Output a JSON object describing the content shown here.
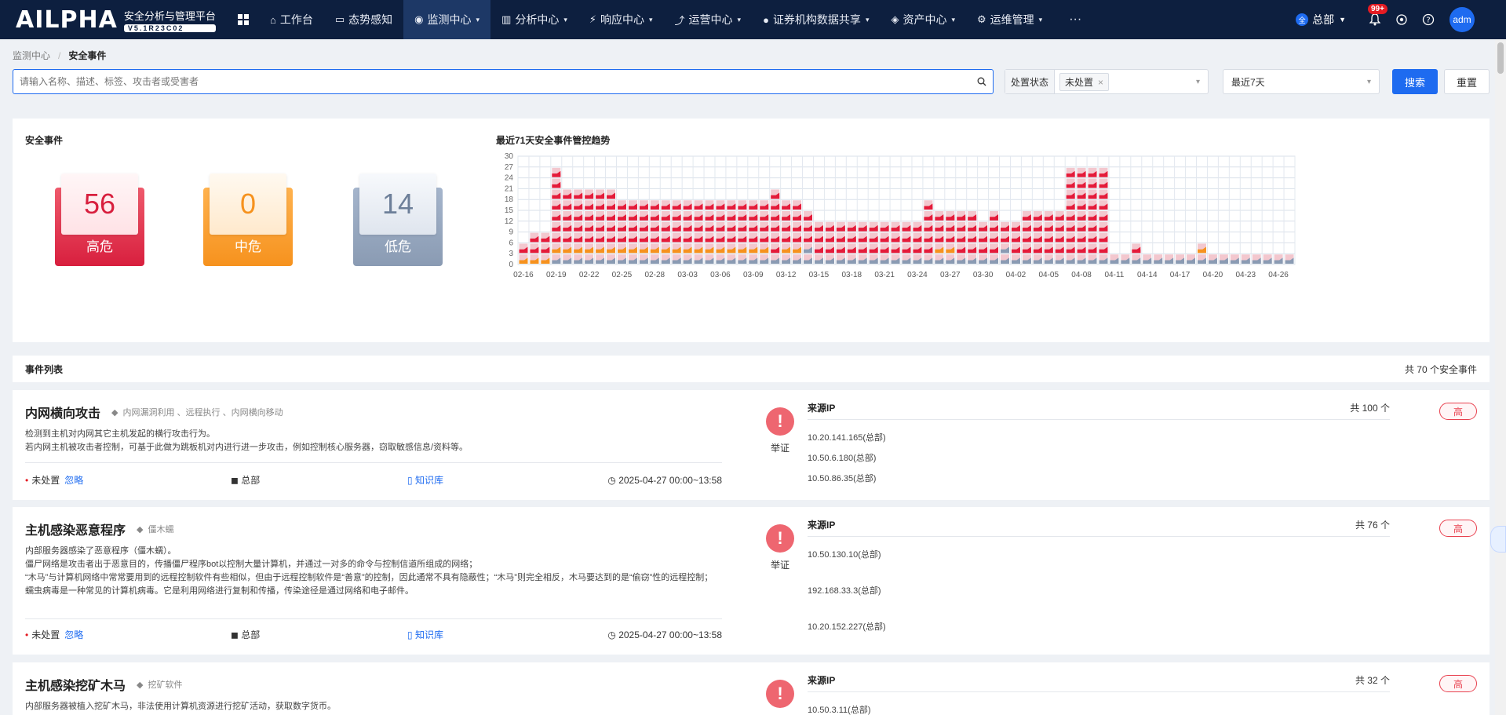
{
  "brand": {
    "logo_word": "AILPHA",
    "product_title": "安全分析与管理平台",
    "version": "V5.1R23C02"
  },
  "nav": {
    "items": [
      {
        "label": "工作台",
        "icon": "home-icon",
        "has_menu": false
      },
      {
        "label": "态势感知",
        "icon": "monitor-icon",
        "has_menu": false
      },
      {
        "label": "监测中心",
        "icon": "radar-icon",
        "has_menu": true,
        "active": true
      },
      {
        "label": "分析中心",
        "icon": "bar-chart-icon",
        "has_menu": true
      },
      {
        "label": "响应中心",
        "icon": "bolt-icon",
        "has_menu": true
      },
      {
        "label": "运营中心",
        "icon": "trend-icon",
        "has_menu": true
      },
      {
        "label": "证券机构数据共享",
        "icon": "share-icon",
        "has_menu": true
      },
      {
        "label": "资产中心",
        "icon": "layers-icon",
        "has_menu": true
      },
      {
        "label": "运维管理",
        "icon": "tools-icon",
        "has_menu": true
      }
    ],
    "more_label": "···",
    "branch_badge": "全",
    "branch": "总部",
    "notification_count": "99+",
    "user": "adm"
  },
  "breadcrumb": {
    "parent": "监测中心",
    "current": "安全事件"
  },
  "search": {
    "placeholder": "请输入名称、描述、标签、攻击者或受害者",
    "value": "",
    "status_label": "处置状态",
    "status_tag": "未处置",
    "range": "最近7天",
    "search_label": "搜索",
    "reset_label": "重置"
  },
  "overview": {
    "title": "安全事件",
    "trend_title": "最近71天安全事件管控趋势",
    "high": {
      "value": "56",
      "label": "高危"
    },
    "mid": {
      "value": "0",
      "label": "中危"
    },
    "low": {
      "value": "14",
      "label": "低危"
    }
  },
  "colors": {
    "high": "#e41b3a",
    "mid": "#f6921e",
    "low": "#8a9bb3",
    "accent": "#1e6bf0",
    "nav_bg": "#0d1f3f"
  },
  "chart_data": {
    "type": "bar",
    "title": "最近71天安全事件管控趋势",
    "xlabel": "",
    "ylabel": "",
    "ylim": [
      0,
      30
    ],
    "yticks": [
      0,
      3,
      6,
      9,
      12,
      15,
      18,
      21,
      24,
      27,
      30
    ],
    "grid": true,
    "stacked": true,
    "x_start": "2025-02-16",
    "xtick_labels": [
      "02-16",
      "02-19",
      "02-22",
      "02-25",
      "02-28",
      "03-03",
      "03-06",
      "03-09",
      "03-12",
      "03-15",
      "03-18",
      "03-21",
      "03-24",
      "03-27",
      "03-30",
      "04-02",
      "04-05",
      "04-08",
      "04-11",
      "04-14",
      "04-17",
      "04-20",
      "04-23",
      "04-26"
    ],
    "series": [
      {
        "name": "低危",
        "values": [
          0,
          0,
          0,
          1,
          1,
          1,
          1,
          1,
          1,
          1,
          1,
          1,
          1,
          1,
          1,
          1,
          1,
          1,
          1,
          1,
          1,
          1,
          1,
          1,
          1,
          1,
          2,
          1,
          1,
          1,
          1,
          1,
          1,
          1,
          1,
          1,
          1,
          1,
          1,
          1,
          1,
          1,
          1,
          1,
          2,
          1,
          1,
          1,
          1,
          1,
          1,
          1,
          1,
          1,
          1,
          1,
          1,
          1,
          1,
          1,
          1,
          1,
          1,
          1,
          1,
          1,
          1,
          1,
          1,
          1,
          1
        ]
      },
      {
        "name": "中危",
        "values": [
          1,
          1,
          1,
          1,
          1,
          1,
          1,
          1,
          1,
          1,
          1,
          1,
          1,
          1,
          1,
          1,
          1,
          1,
          1,
          1,
          1,
          1,
          1,
          0,
          1,
          1,
          0,
          0,
          0,
          0,
          0,
          0,
          0,
          0,
          0,
          0,
          0,
          0,
          1,
          1,
          0,
          0,
          0,
          0,
          0,
          0,
          0,
          0,
          0,
          0,
          0,
          0,
          0,
          0,
          0,
          0,
          0,
          0,
          0,
          0,
          0,
          0,
          1,
          0,
          0,
          0,
          0,
          0,
          0,
          0,
          0
        ]
      },
      {
        "name": "高危",
        "values": [
          1,
          2,
          2,
          7,
          5,
          5,
          5,
          5,
          5,
          4,
          4,
          4,
          4,
          4,
          4,
          4,
          4,
          4,
          4,
          4,
          4,
          4,
          4,
          6,
          4,
          4,
          3,
          3,
          3,
          3,
          3,
          3,
          3,
          3,
          3,
          3,
          3,
          5,
          3,
          3,
          4,
          4,
          3,
          4,
          2,
          3,
          4,
          4,
          4,
          4,
          8,
          8,
          8,
          8,
          0,
          0,
          1,
          0,
          0,
          0,
          0,
          0,
          0,
          0,
          0,
          0,
          0,
          0,
          0,
          0,
          0
        ]
      }
    ],
    "note": "71 daily columns from 02-16 to 04-27; each stacked cell represents 3 events"
  },
  "list": {
    "title": "事件列表",
    "total": "共 70 个安全事件",
    "events": [
      {
        "title": "内网横向攻击",
        "tags": "内网漏洞利用 、远程执行 、内网横向移动",
        "desc": [
          "检测到主机对内网其它主机发起的横行攻击行为。",
          "若内网主机被攻击者控制，可基于此做为跳板机对内进行进一步攻击，例如控制核心服务器，窃取敏感信息/资料等。"
        ],
        "status": "未处置",
        "ignore": "忽略",
        "branch": "总部",
        "kb": "知识库",
        "time": "2025-04-27 00:00~13:58",
        "evidence": "举证",
        "src_label": "来源IP",
        "src_count": "共 100 个",
        "ips": [
          "10.20.141.165(总部)",
          "10.50.6.180(总部)",
          "10.50.86.35(总部)"
        ],
        "level": "高"
      },
      {
        "title": "主机感染恶意程序",
        "tags": "僵木蠕",
        "desc": [
          "内部服务器感染了恶意程序（僵木蠕）。",
          "僵尸网络是攻击者出于恶意目的，传播僵尸程序bot以控制大量计算机，并通过一对多的命令与控制信道所组成的网络；",
          "“木马”与计算机网络中常常要用到的远程控制软件有些相似，但由于远程控制软件是“善意”的控制，因此通常不具有隐蔽性；“木马”则完全相反，木马要达到的是“偷窃”性的远程控制；",
          "蠕虫病毒是一种常见的计算机病毒。它是利用网络进行复制和传播，传染途径是通过网络和电子邮件。"
        ],
        "status": "未处置",
        "ignore": "忽略",
        "branch": "总部",
        "kb": "知识库",
        "time": "2025-04-27 00:00~13:58",
        "evidence": "举证",
        "src_label": "来源IP",
        "src_count": "共 76 个",
        "ips": [
          "10.50.130.10(总部)",
          "192.168.33.3(总部)",
          "10.20.152.227(总部)"
        ],
        "level": "高"
      },
      {
        "title": "主机感染挖矿木马",
        "tags": "挖矿软件",
        "desc": [
          "内部服务器被植入挖矿木马，非法使用计算机资源进行挖矿活动，获取数字货币。"
        ],
        "src_label": "来源IP",
        "src_count": "共 32 个",
        "ips": [
          "10.50.3.11(总部)"
        ],
        "level": "高"
      }
    ]
  }
}
